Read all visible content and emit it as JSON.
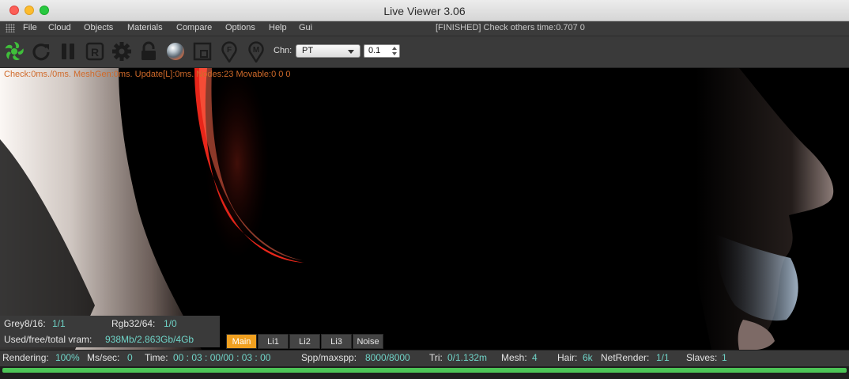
{
  "window": {
    "title": "Live Viewer 3.06"
  },
  "menu": {
    "items": [
      "File",
      "Cloud",
      "Objects",
      "Materials",
      "Compare",
      "Options",
      "Help",
      "Gui"
    ],
    "status": "[FINISHED] Check others time:0.707  0"
  },
  "toolbar": {
    "icons": [
      "octane-logo-icon",
      "refresh-icon",
      "pause-icon",
      "region-render-icon",
      "settings-gear-icon",
      "lock-icon",
      "material-sphere-icon",
      "crop-frame-icon",
      "focus-pin-icon",
      "material-pin-icon"
    ],
    "icon_letters": {
      "region": "R",
      "focus": "F",
      "material": "M"
    },
    "channel_label": "Chn:",
    "channel_value": "PT",
    "spin_value": "0.1"
  },
  "viewport": {
    "stats": "Check:0ms./0ms. MeshGen:0ms. Update[L]:0ms. Nodes:23 Movable:0  0 0"
  },
  "memory": {
    "grey_label": "Grey8/16:",
    "grey_value": "1/1",
    "rgb_label": "Rgb32/64:",
    "rgb_value": "1/0",
    "vram_label": "Used/free/total vram:",
    "vram_value": "938Mb/2.863Gb/4Gb"
  },
  "passes": {
    "tabs": [
      "Main",
      "Li1",
      "Li2",
      "Li3",
      "Noise"
    ],
    "active": "Main"
  },
  "statusbar": {
    "rendering_label": "Rendering:",
    "rendering_value": "100%",
    "ms_label": "Ms/sec:",
    "ms_value": "0",
    "time_label": "Time:",
    "time_value": "00 : 03 : 00/00 : 03 : 00",
    "spp_label": "Spp/maxspp:",
    "spp_value": "8000/8000",
    "tri_label": "Tri:",
    "tri_value": "0/1.132m",
    "mesh_label": "Mesh:",
    "mesh_value": "4",
    "hair_label": "Hair:",
    "hair_value": "6k",
    "netrender_label": "NetRender:",
    "netrender_value": "1/1",
    "slaves_label": "Slaves:",
    "slaves_value": "1"
  },
  "progress": {
    "percent": 100
  },
  "colors": {
    "accent": "#f0a020",
    "value": "#6fd3c7",
    "progress": "#4cc556",
    "stats": "#d06a2a"
  }
}
